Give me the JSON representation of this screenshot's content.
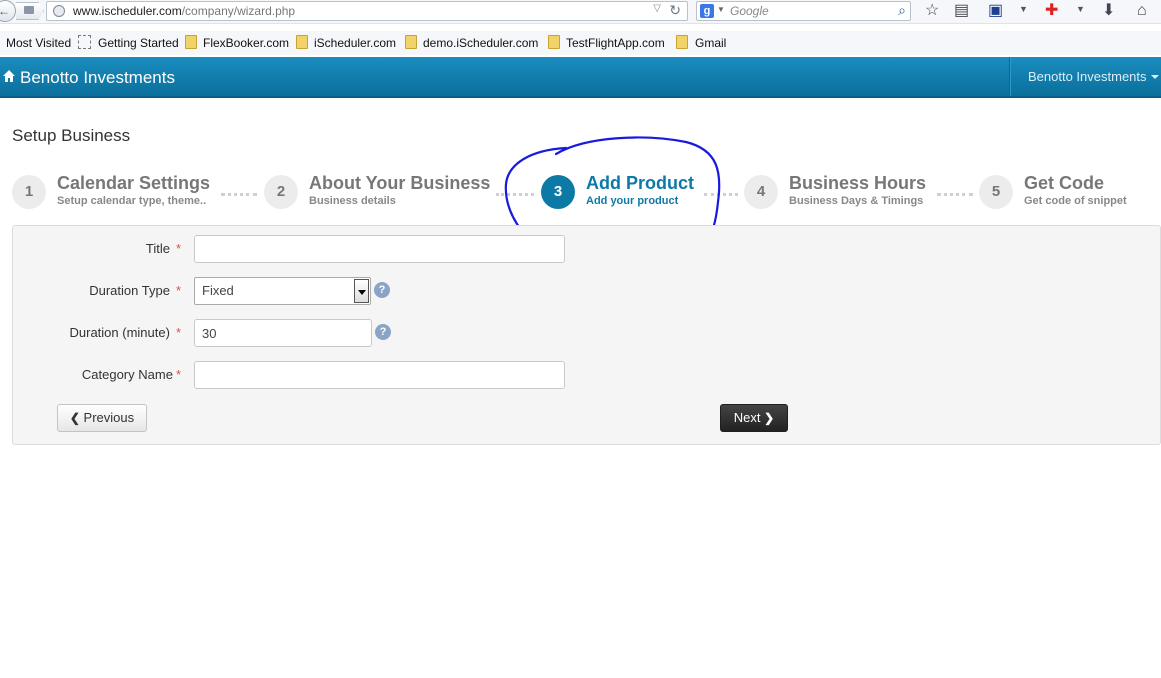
{
  "browser": {
    "url_host": "www.ischeduler.com",
    "url_path": "/company/wizard.php",
    "search_placeholder": "Google",
    "search_engine_letter": "g"
  },
  "bookmarks": [
    {
      "label": "Most Visited"
    },
    {
      "label": "Getting Started"
    },
    {
      "label": "FlexBooker.com"
    },
    {
      "label": "iScheduler.com"
    },
    {
      "label": "demo.iScheduler.com"
    },
    {
      "label": "TestFlightApp.com"
    },
    {
      "label": "Gmail"
    }
  ],
  "app": {
    "brand": "Benotto Investments",
    "user": "Benotto Investments",
    "accent_color": "#0d7aa6"
  },
  "page": {
    "title": "Setup Business"
  },
  "wizard": {
    "active_step": 3,
    "steps": [
      {
        "number": "1",
        "title": "Calendar Settings",
        "subtitle": "Setup calendar type, theme.."
      },
      {
        "number": "2",
        "title": "About Your Business",
        "subtitle": "Business details"
      },
      {
        "number": "3",
        "title": "Add Product",
        "subtitle": "Add your product"
      },
      {
        "number": "4",
        "title": "Business Hours",
        "subtitle": "Business Days & Timings"
      },
      {
        "number": "5",
        "title": "Get Code",
        "subtitle": "Get code of snippet"
      }
    ]
  },
  "form": {
    "required_mark": "*",
    "title": {
      "label": "Title",
      "value": ""
    },
    "duration_type": {
      "label": "Duration Type",
      "value": "Fixed"
    },
    "duration": {
      "label": "Duration (minute)",
      "value": "30"
    },
    "category": {
      "label": "Category Name",
      "value": ""
    },
    "help_glyph": "?",
    "previous_label": "Previous",
    "next_label": "Next"
  }
}
